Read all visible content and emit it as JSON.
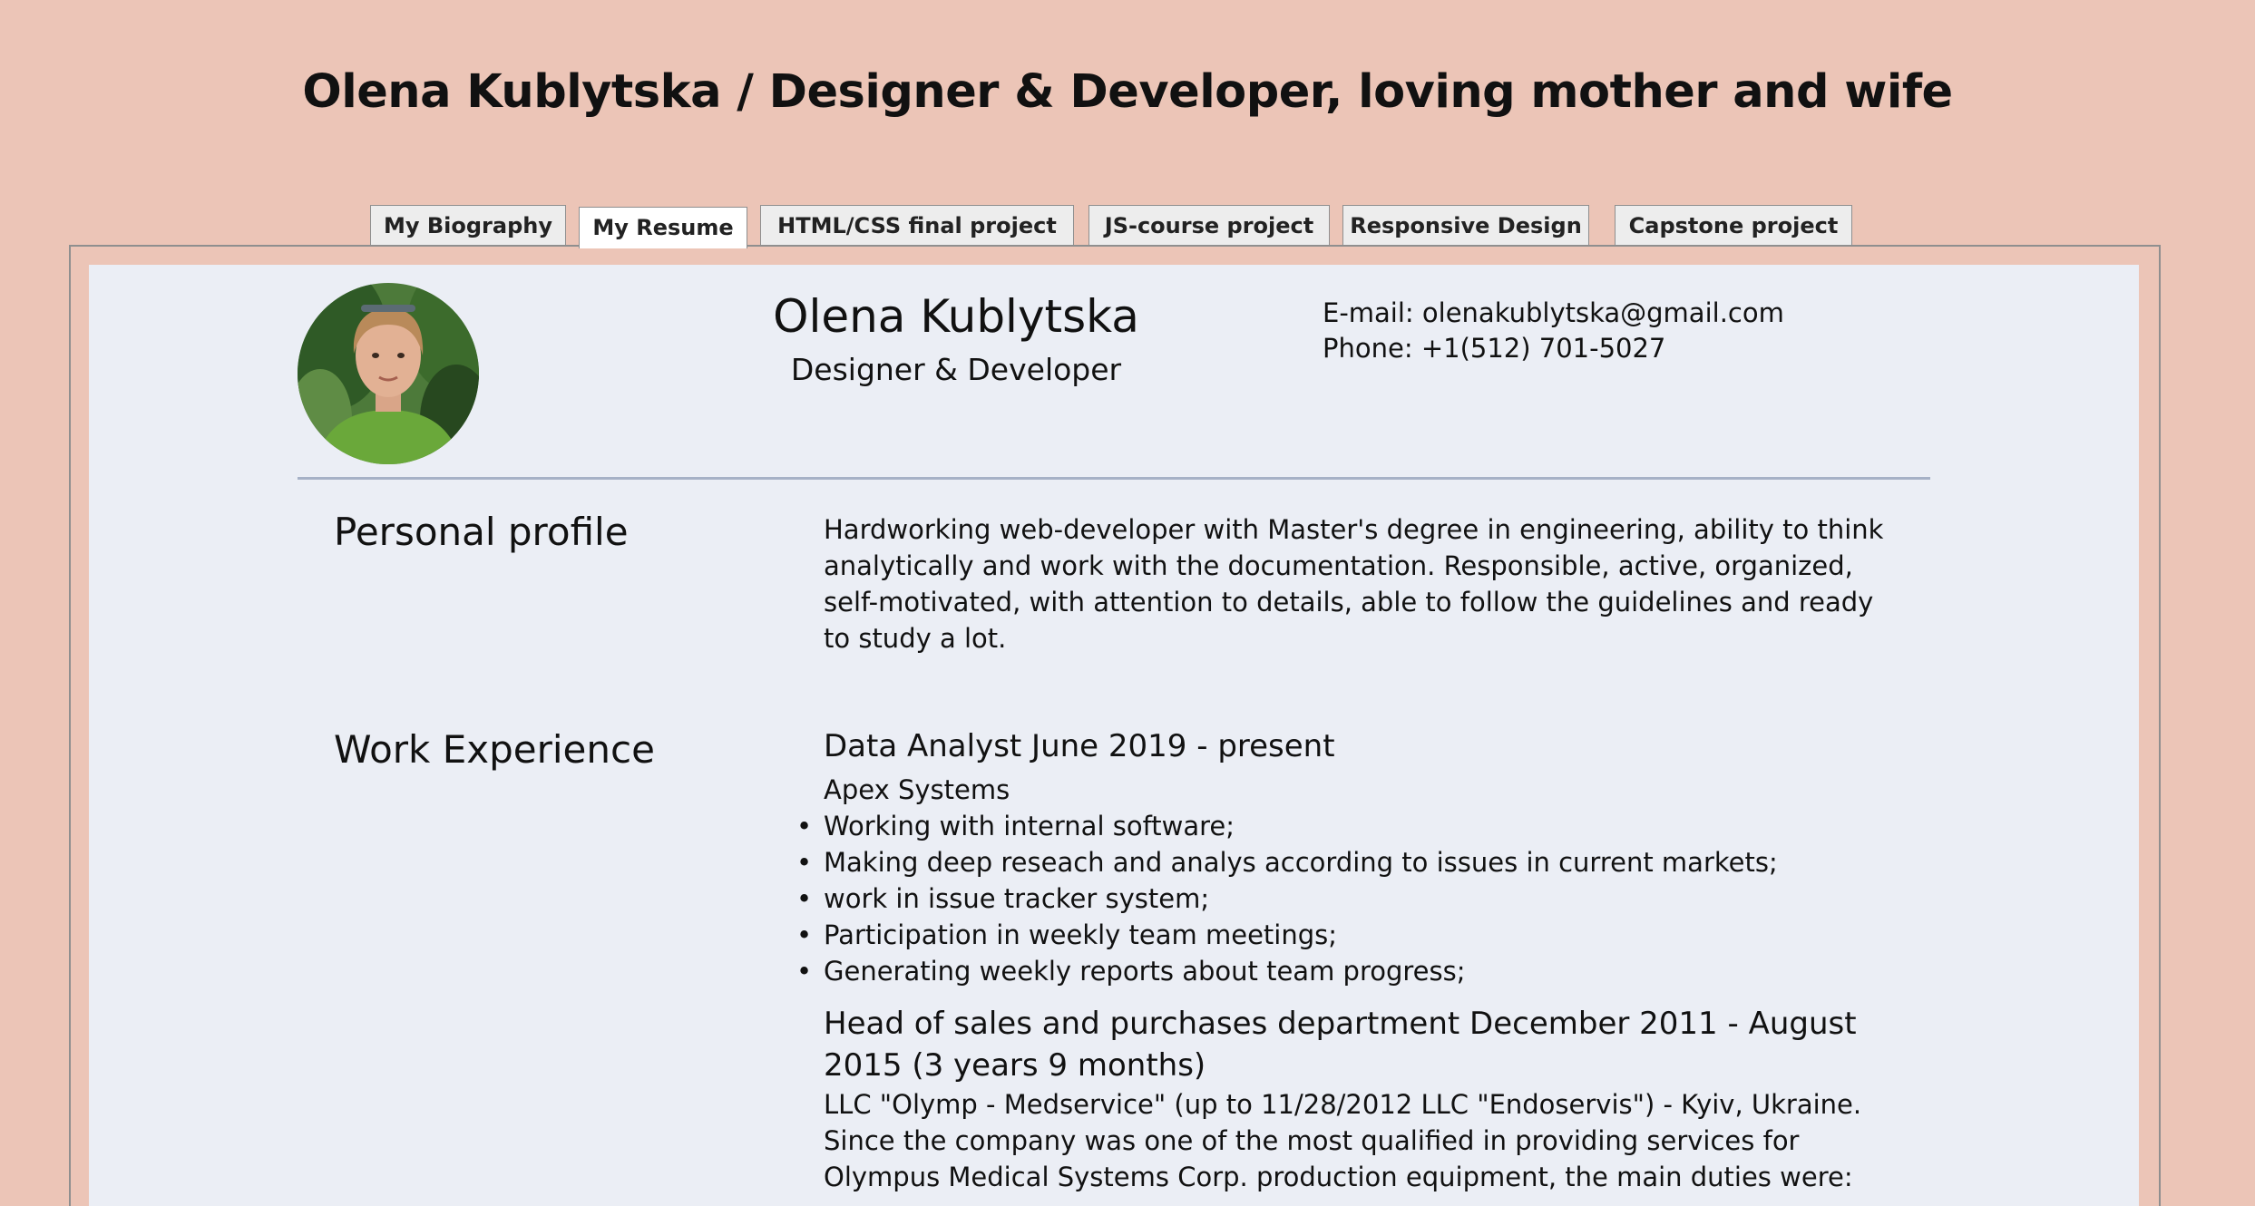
{
  "page": {
    "title": "Olena Kublytska / Designer & Developer, loving mother and wife"
  },
  "tabs": [
    {
      "label": "My Biography",
      "active": false
    },
    {
      "label": "My Resume",
      "active": true
    },
    {
      "label": "HTML/CSS final project",
      "active": false
    },
    {
      "label": "JS-course project",
      "active": false
    },
    {
      "label": "Responsive Design",
      "active": false
    },
    {
      "label": "Capstone project",
      "active": false
    }
  ],
  "resume": {
    "name": "Olena Kublytska",
    "role": "Designer & Developer",
    "email": "E-mail: olenakublytska@gmail.com",
    "phone": "Phone: +1(512) 701-5027",
    "profile_heading": "Personal profile",
    "profile_text": "Hardworking web-developer with Master's degree in engineering, ability to think analytically and work with the documentation. Responsible, active, organized, self-motivated, with attention to details, able to follow the guidelines and ready to study a lot.",
    "work_heading": "Work Experience",
    "jobs": [
      {
        "title": "Data Analyst June 2019 - present",
        "company": "Apex Systems",
        "duties": [
          "Working with internal software;",
          "Making deep reseach and analys according to issues in current markets;",
          "work in issue tracker system;",
          "Participation in weekly team meetings;",
          "Generating weekly reports about team progress;"
        ]
      },
      {
        "title": "Head of sales and purchases department December 2011 - August 2015 (3 years 9 months)",
        "company": "LLC \"Olymp - Medservice\" (up to 11/28/2012 LLC \"Endoservis\") - Kyiv, Ukraine.",
        "description": "Since the company was one of the most qualified in providing services for Olympus Medical Systems Corp. production equipment, the main duties were:"
      }
    ]
  },
  "colors": {
    "page_background": "#ecc5b7",
    "panel_background": "#ebeef5",
    "divider": "#a6b1c6"
  }
}
